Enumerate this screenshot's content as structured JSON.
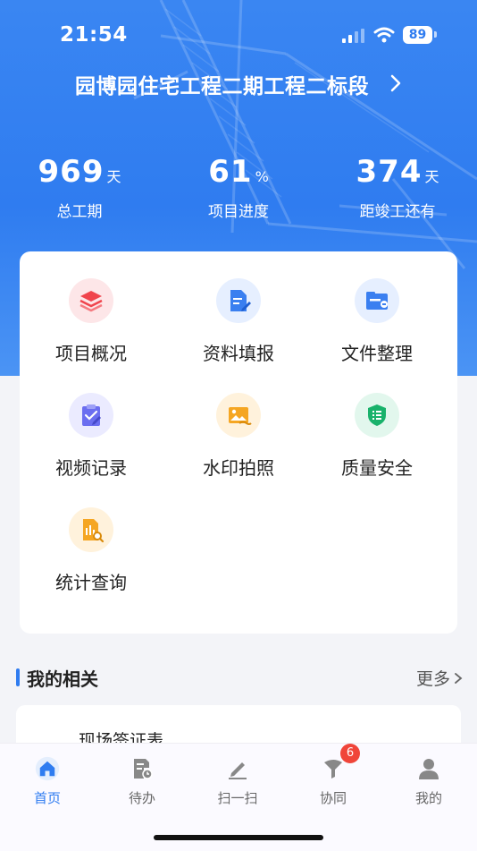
{
  "status_bar": {
    "time": "21:54",
    "battery": "89"
  },
  "header": {
    "project_title": "园博园住宅工程二期工程二标段"
  },
  "stats": [
    {
      "value": "969",
      "unit": "天",
      "label": "总工期"
    },
    {
      "value": "61",
      "unit": "%",
      "label": "项目进度"
    },
    {
      "value": "374",
      "unit": "天",
      "label": "距竣工还有"
    }
  ],
  "menu": [
    {
      "label": "项目概况",
      "icon": "layers-icon",
      "color": "#f0444c",
      "bg": "#fde6e8"
    },
    {
      "label": "资料填报",
      "icon": "document-edit-icon",
      "color": "#3a7ff0",
      "bg": "#e6efff"
    },
    {
      "label": "文件整理",
      "icon": "folder-icon",
      "color": "#3a7ff0",
      "bg": "#e6efff"
    },
    {
      "label": "视频记录",
      "icon": "clipboard-edit-icon",
      "color": "#6b6ef0",
      "bg": "#ebebff"
    },
    {
      "label": "水印拍照",
      "icon": "picture-icon",
      "color": "#f5a623",
      "bg": "#fff2dc"
    },
    {
      "label": "质量安全",
      "icon": "shield-list-icon",
      "color": "#19b26b",
      "bg": "#e2f7ed"
    },
    {
      "label": "统计查询",
      "icon": "report-search-icon",
      "color": "#f5a623",
      "bg": "#fff2dc"
    }
  ],
  "section": {
    "title": "我的相关",
    "more_label": "更多"
  },
  "list": [
    {
      "title": "现场签证表"
    }
  ],
  "tabs": [
    {
      "label": "首页",
      "icon": "home-icon",
      "active": true
    },
    {
      "label": "待办",
      "icon": "todo-icon",
      "active": false
    },
    {
      "label": "扫一扫",
      "icon": "scan-pen-icon",
      "active": false
    },
    {
      "label": "协同",
      "icon": "collaborate-icon",
      "active": false,
      "badge": "6"
    },
    {
      "label": "我的",
      "icon": "user-icon",
      "active": false
    }
  ],
  "colors": {
    "accent": "#2f7cf0",
    "badge": "#f0453a"
  }
}
